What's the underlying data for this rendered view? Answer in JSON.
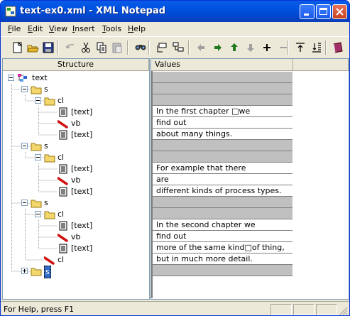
{
  "window": {
    "title": "text-ex0.xml - XML Notepad"
  },
  "menu": [
    "File",
    "Edit",
    "View",
    "Insert",
    "Tools",
    "Help"
  ],
  "toolbar": [
    {
      "icon": "new-icon"
    },
    {
      "icon": "open-icon"
    },
    {
      "icon": "save-icon"
    },
    {
      "icon": "undo-icon"
    },
    {
      "icon": "cut-icon"
    },
    {
      "icon": "copy-icon"
    },
    {
      "icon": "paste-icon"
    },
    {
      "icon": "find-icon"
    },
    {
      "icon": "insert-element-icon"
    },
    {
      "icon": "insert-child-icon"
    },
    {
      "icon": "arrow-left-icon"
    },
    {
      "icon": "arrow-right-icon"
    },
    {
      "icon": "arrow-up-icon"
    },
    {
      "icon": "arrow-down-icon"
    },
    {
      "icon": "expand-icon"
    },
    {
      "icon": "collapse-icon"
    },
    {
      "icon": "expand-all-icon"
    },
    {
      "icon": "collapse-all-icon"
    },
    {
      "icon": "help-book-icon"
    }
  ],
  "structure_header": "Structure",
  "values_header": "Values",
  "tree": [
    {
      "label": "text",
      "depth": 0,
      "kind": "root",
      "toggle": "minus"
    },
    {
      "label": "s",
      "depth": 1,
      "kind": "folder",
      "toggle": "minus"
    },
    {
      "label": "cl",
      "depth": 2,
      "kind": "folder",
      "toggle": "minus"
    },
    {
      "label": "[text]",
      "depth": 3,
      "kind": "text"
    },
    {
      "label": "vb",
      "depth": 3,
      "kind": "leaf"
    },
    {
      "label": "[text]",
      "depth": 3,
      "kind": "text"
    },
    {
      "label": "s",
      "depth": 1,
      "kind": "folder",
      "toggle": "minus"
    },
    {
      "label": "cl",
      "depth": 2,
      "kind": "folder",
      "toggle": "minus"
    },
    {
      "label": "[text]",
      "depth": 3,
      "kind": "text"
    },
    {
      "label": "vb",
      "depth": 3,
      "kind": "leaf"
    },
    {
      "label": "[text]",
      "depth": 3,
      "kind": "text"
    },
    {
      "label": "s",
      "depth": 1,
      "kind": "folder",
      "toggle": "minus"
    },
    {
      "label": "cl",
      "depth": 2,
      "kind": "folder",
      "toggle": "minus"
    },
    {
      "label": "[text]",
      "depth": 3,
      "kind": "text"
    },
    {
      "label": "vb",
      "depth": 3,
      "kind": "leaf"
    },
    {
      "label": "[text]",
      "depth": 3,
      "kind": "text"
    },
    {
      "label": "cl",
      "depth": 2,
      "kind": "leaf"
    },
    {
      "label": "s",
      "depth": 1,
      "kind": "folder",
      "toggle": "plus",
      "selected": true
    }
  ],
  "values": [
    {
      "text": "",
      "gray": true
    },
    {
      "text": "",
      "gray": true
    },
    {
      "text": "",
      "gray": true
    },
    {
      "text": "In the first chapter □we",
      "gray": false
    },
    {
      "text": "find out",
      "gray": false
    },
    {
      "text": "about many things.",
      "gray": false
    },
    {
      "text": "",
      "gray": true
    },
    {
      "text": "",
      "gray": true
    },
    {
      "text": "For example that there",
      "gray": false
    },
    {
      "text": "are",
      "gray": false
    },
    {
      "text": "different kinds of process types.",
      "gray": false
    },
    {
      "text": "",
      "gray": true
    },
    {
      "text": "",
      "gray": true
    },
    {
      "text": "In the second chapter we",
      "gray": false
    },
    {
      "text": "find out",
      "gray": false
    },
    {
      "text": "more of the same kind□of thing,",
      "gray": false
    },
    {
      "text": "but in much more detail.",
      "gray": false
    },
    {
      "text": "",
      "gray": true
    }
  ],
  "status": {
    "text": "For Help, press F1"
  },
  "colors": {
    "titlebar": "#0054e3",
    "selection": "#316ac5",
    "gray_cell": "#c0c0c0"
  }
}
